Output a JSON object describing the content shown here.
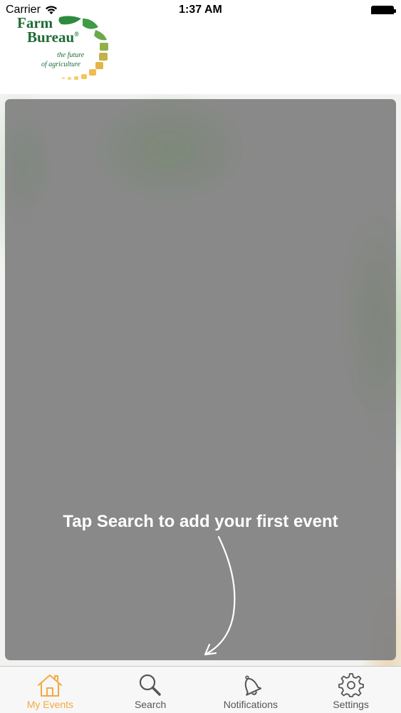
{
  "status_bar": {
    "carrier": "Carrier",
    "time": "1:37 AM"
  },
  "logo": {
    "line1": "Farm",
    "line2": "Bureau",
    "registered": "®",
    "tagline1": "the future",
    "tagline2": "of agriculture"
  },
  "empty_state": {
    "message": "Tap Search to add your first event"
  },
  "tabs": [
    {
      "label": "My Events",
      "icon": "home-icon",
      "active": true
    },
    {
      "label": "Search",
      "icon": "search-icon",
      "active": false
    },
    {
      "label": "Notifications",
      "icon": "bell-icon",
      "active": false
    },
    {
      "label": "Settings",
      "icon": "gear-icon",
      "active": false
    }
  ],
  "colors": {
    "active_tab": "#f4a940",
    "inactive_tab": "#555555",
    "brand_green": "#1f6b35",
    "overlay": "#808080"
  }
}
